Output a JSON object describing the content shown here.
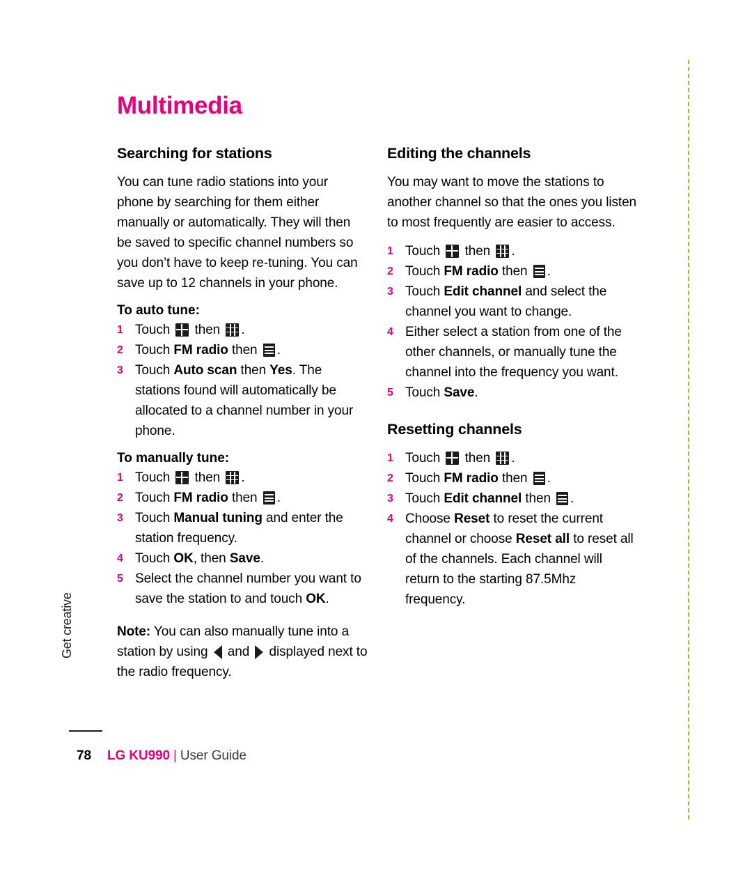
{
  "page": {
    "title": "Multimedia",
    "number": "78",
    "side_tab": "Get creative",
    "footer_brand": "LG KU990",
    "footer_separator": "|",
    "footer_guide": "User Guide",
    "accent_color": "#e6007e",
    "rule_color": "#8cc63f"
  },
  "left_column": {
    "heading": "Searching for stations",
    "intro": "You can tune radio stations into your phone by searching for them either manually or automatically. They will then be saved to specific channel numbers so you don’t have to keep re-tuning. You can save up to 12 channels in your phone.",
    "auto_tune": {
      "heading": "To auto tune:",
      "steps": [
        {
          "num": "1",
          "prefix": "Touch ",
          "icon1": "grid4-icon",
          "middle": " then ",
          "icon2": "grid9-icon",
          "suffix": "."
        },
        {
          "num": "2",
          "prefix": "Touch ",
          "bold1": "FM radio",
          "middle": " then ",
          "icon2": "list-icon",
          "suffix": "."
        },
        {
          "num": "3",
          "prefix": "Touch ",
          "bold1": "Auto scan",
          "middle": " then ",
          "bold2": "Yes",
          "suffix": ". The stations found will automatically be allocated to a channel number in your phone."
        }
      ]
    },
    "manual_tune": {
      "heading": "To manually tune:",
      "steps": [
        {
          "num": "1",
          "prefix": "Touch ",
          "icon1": "grid4-icon",
          "middle": " then ",
          "icon2": "grid9-icon",
          "suffix": "."
        },
        {
          "num": "2",
          "prefix": "Touch ",
          "bold1": "FM radio",
          "middle": " then ",
          "icon2": "list-icon",
          "suffix": "."
        },
        {
          "num": "3",
          "prefix": "Touch ",
          "bold1": "Manual tuning",
          "suffix": " and enter the station frequency."
        },
        {
          "num": "4",
          "prefix": "Touch ",
          "bold1": "OK",
          "middle": ", then ",
          "bold2": "Save",
          "suffix": "."
        },
        {
          "num": "5",
          "prefix": "Select the channel number you want to save the station to and touch ",
          "bold1": "OK",
          "suffix": "."
        }
      ]
    },
    "note": {
      "lead": "Note:",
      "part1": " You can also manually tune into a station by using ",
      "icon_left": "triangle-left-icon",
      "part2": " and ",
      "icon_right": "triangle-right-icon",
      "part3": " displayed next to the radio frequency."
    }
  },
  "right_column": {
    "editing": {
      "heading": "Editing the channels",
      "intro": "You may want to move the stations to another channel so that the ones you listen to most frequently are easier to access.",
      "steps": [
        {
          "num": "1",
          "prefix": "Touch ",
          "icon1": "grid4-icon",
          "middle": " then ",
          "icon2": "grid9-icon",
          "suffix": "."
        },
        {
          "num": "2",
          "prefix": "Touch ",
          "bold1": "FM radio",
          "middle": " then ",
          "icon2": "list-icon",
          "suffix": "."
        },
        {
          "num": "3",
          "prefix": "Touch ",
          "bold1": "Edit channel",
          "suffix": " and select the channel you want to change."
        },
        {
          "num": "4",
          "prefix": "Either select a station from one of the other channels, or manually tune the channel into the frequency you want."
        },
        {
          "num": "5",
          "prefix": "Touch ",
          "bold1": "Save",
          "suffix": "."
        }
      ]
    },
    "resetting": {
      "heading": "Resetting channels",
      "steps": [
        {
          "num": "1",
          "prefix": "Touch ",
          "icon1": "grid4-icon",
          "middle": " then ",
          "icon2": "grid9-icon",
          "suffix": "."
        },
        {
          "num": "2",
          "prefix": "Touch ",
          "bold1": "FM radio",
          "middle": " then ",
          "icon2": "list-icon",
          "suffix": "."
        },
        {
          "num": "3",
          "prefix": "Touch ",
          "bold1": "Edit channel",
          "middle": " then ",
          "icon2": "list-icon",
          "suffix": "."
        },
        {
          "num": "4",
          "prefix": "Choose ",
          "bold1": "Reset",
          "middle": " to reset the current channel or choose ",
          "bold2": "Reset all",
          "suffix": " to reset all of the channels. Each channel will return to the starting 87.5Mhz frequency."
        }
      ]
    }
  }
}
